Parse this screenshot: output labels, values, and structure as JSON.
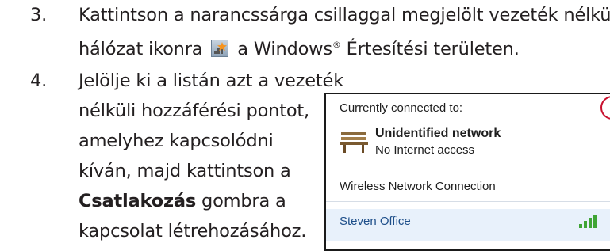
{
  "step3": {
    "number": "3.",
    "line1": "Kattintson a narancssárga csillaggal megjelölt vezeték nélküli",
    "line2_before": "hálózat ikonra",
    "line2_after_a": "a Windows",
    "reg_mark": "®",
    "line2_after_b": " Értesítési területen."
  },
  "step4": {
    "number": "4.",
    "line1": "Jelölje ki a listán azt a vezeték",
    "line2": "nélküli hozzáférési pontot,",
    "line3": "amelyhez kapcsolódni",
    "line4": "kíván, majd kattintson a",
    "line5_bold": "Csatlakozás",
    "line5_rest": " gombra a",
    "line6": "kapcsolat létrehozásához."
  },
  "panel": {
    "connected_label": "Currently connected to:",
    "network_name": "Unidentified network",
    "network_status": "No Internet access",
    "section_title": "Wireless Network Connection",
    "selected_network": "Steven Office"
  },
  "colors": {
    "text": "#231f20",
    "highlight_circle": "#c8102e",
    "selection_bg": "#e8f1fb",
    "link_text": "#1e4f8a",
    "star": "#f7941d"
  },
  "icons": {
    "tray": "wireless-network-star-icon",
    "network": "bench-icon",
    "signal": "signal-bars-icon"
  }
}
